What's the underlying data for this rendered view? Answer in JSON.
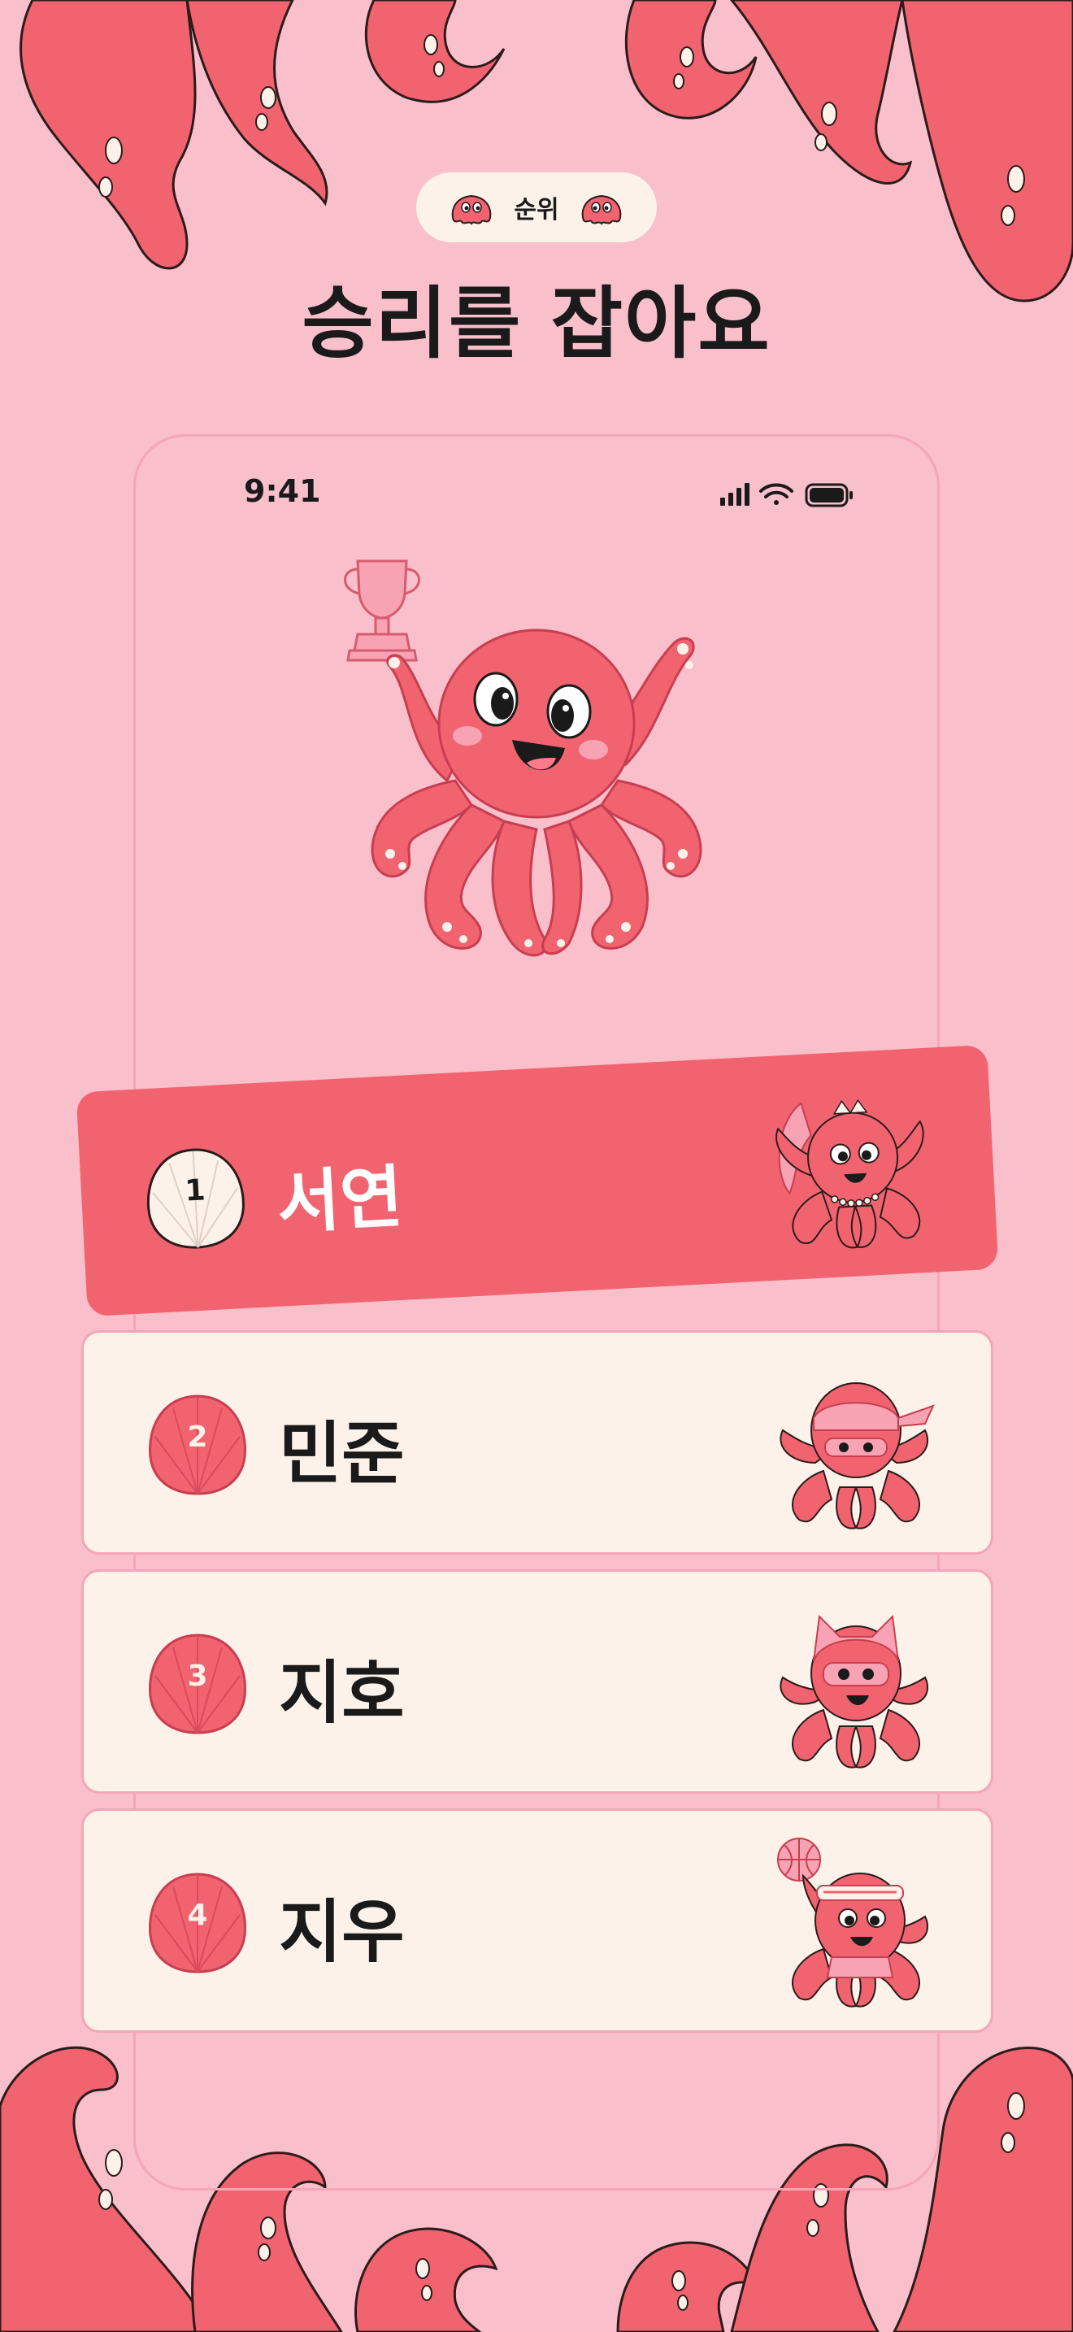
{
  "header": {
    "badge_label": "순위",
    "headline": "승리를 잡아요"
  },
  "status_bar": {
    "time": "9:41"
  },
  "leaderboard": [
    {
      "rank": "1",
      "name": "서연",
      "highlighted": true
    },
    {
      "rank": "2",
      "name": "민준",
      "highlighted": false
    },
    {
      "rank": "3",
      "name": "지호",
      "highlighted": false
    },
    {
      "rank": "4",
      "name": "지우",
      "highlighted": false
    }
  ],
  "colors": {
    "background": "#f9bfcb",
    "accent": "#f26370",
    "card": "#fcf2ea",
    "text": "#1a1a1a"
  },
  "icons": [
    "octopus-mascot-icon",
    "trophy-icon",
    "shell-icon",
    "signal-icon",
    "wifi-icon",
    "battery-icon"
  ]
}
